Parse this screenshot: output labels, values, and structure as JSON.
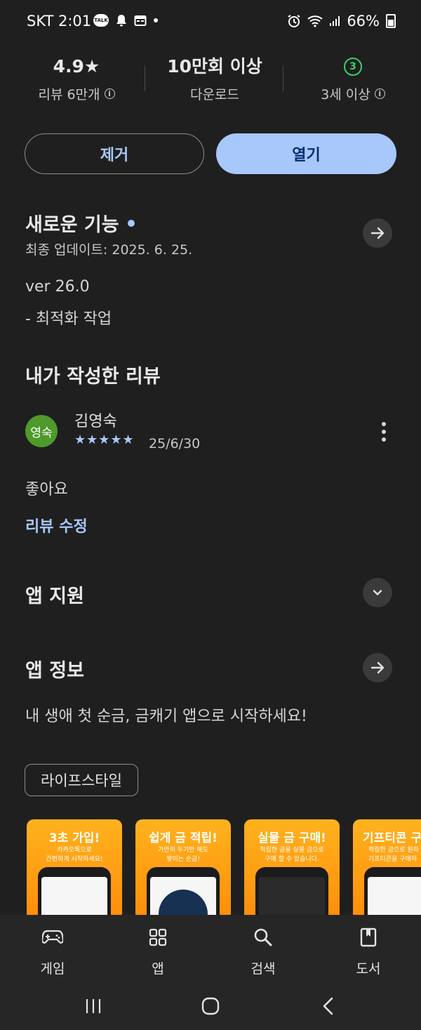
{
  "status_bar": {
    "time": "SKT 2:01",
    "talk_label": "TALK",
    "battery": "66%"
  },
  "stats": {
    "rating": "4.9★",
    "reviews": "리뷰 6만개",
    "downloads": "10만회 이상",
    "downloads_label": "다운로드",
    "age_badge": "3",
    "age_label": "3세 이상"
  },
  "actions": {
    "remove": "제거",
    "open": "열기"
  },
  "whats_new": {
    "title": "새로운 기능",
    "updated": "최종 업데이트: 2025. 6. 25.",
    "version": "ver 26.0",
    "note": "- 최적화 작업"
  },
  "my_review": {
    "title": "내가 작성한 리뷰",
    "avatar": "영숙",
    "author": "김영숙",
    "stars": "★★★★★",
    "date": "25/6/30",
    "text": "좋아요",
    "edit": "리뷰 수정"
  },
  "app_support": {
    "title": "앱 지원"
  },
  "app_info": {
    "title": "앱 정보",
    "description": "내 생애 첫 순금, 금캐기 앱으로 시작하세요!",
    "category": "라이프스타일"
  },
  "screenshots": [
    {
      "title": "3초 가입!",
      "subtitle": "카카오톡으로\n간편하게 시작하세요!"
    },
    {
      "title": "쉽게 금 적립!",
      "subtitle": "가만히 두기만 해도\n쌓이는 순금!"
    },
    {
      "title": "실물 금 구매!",
      "subtitle": "적립한 금을 실물 금으로\n구매 할 수 있습니다."
    },
    {
      "title": "기프티콘 구",
      "subtitle": "적립한 금으로 원하\n기프티콘을 구매하"
    }
  ],
  "bottom_nav": {
    "games": "게임",
    "apps": "앱",
    "search": "검색",
    "books": "도서"
  },
  "colors": {
    "background": "#1f1f1f",
    "accent": "#a8c7fa",
    "age_green": "#3ccf6a",
    "avatar_green": "#4e9a2a",
    "shot_orange": "#ff9f14"
  }
}
